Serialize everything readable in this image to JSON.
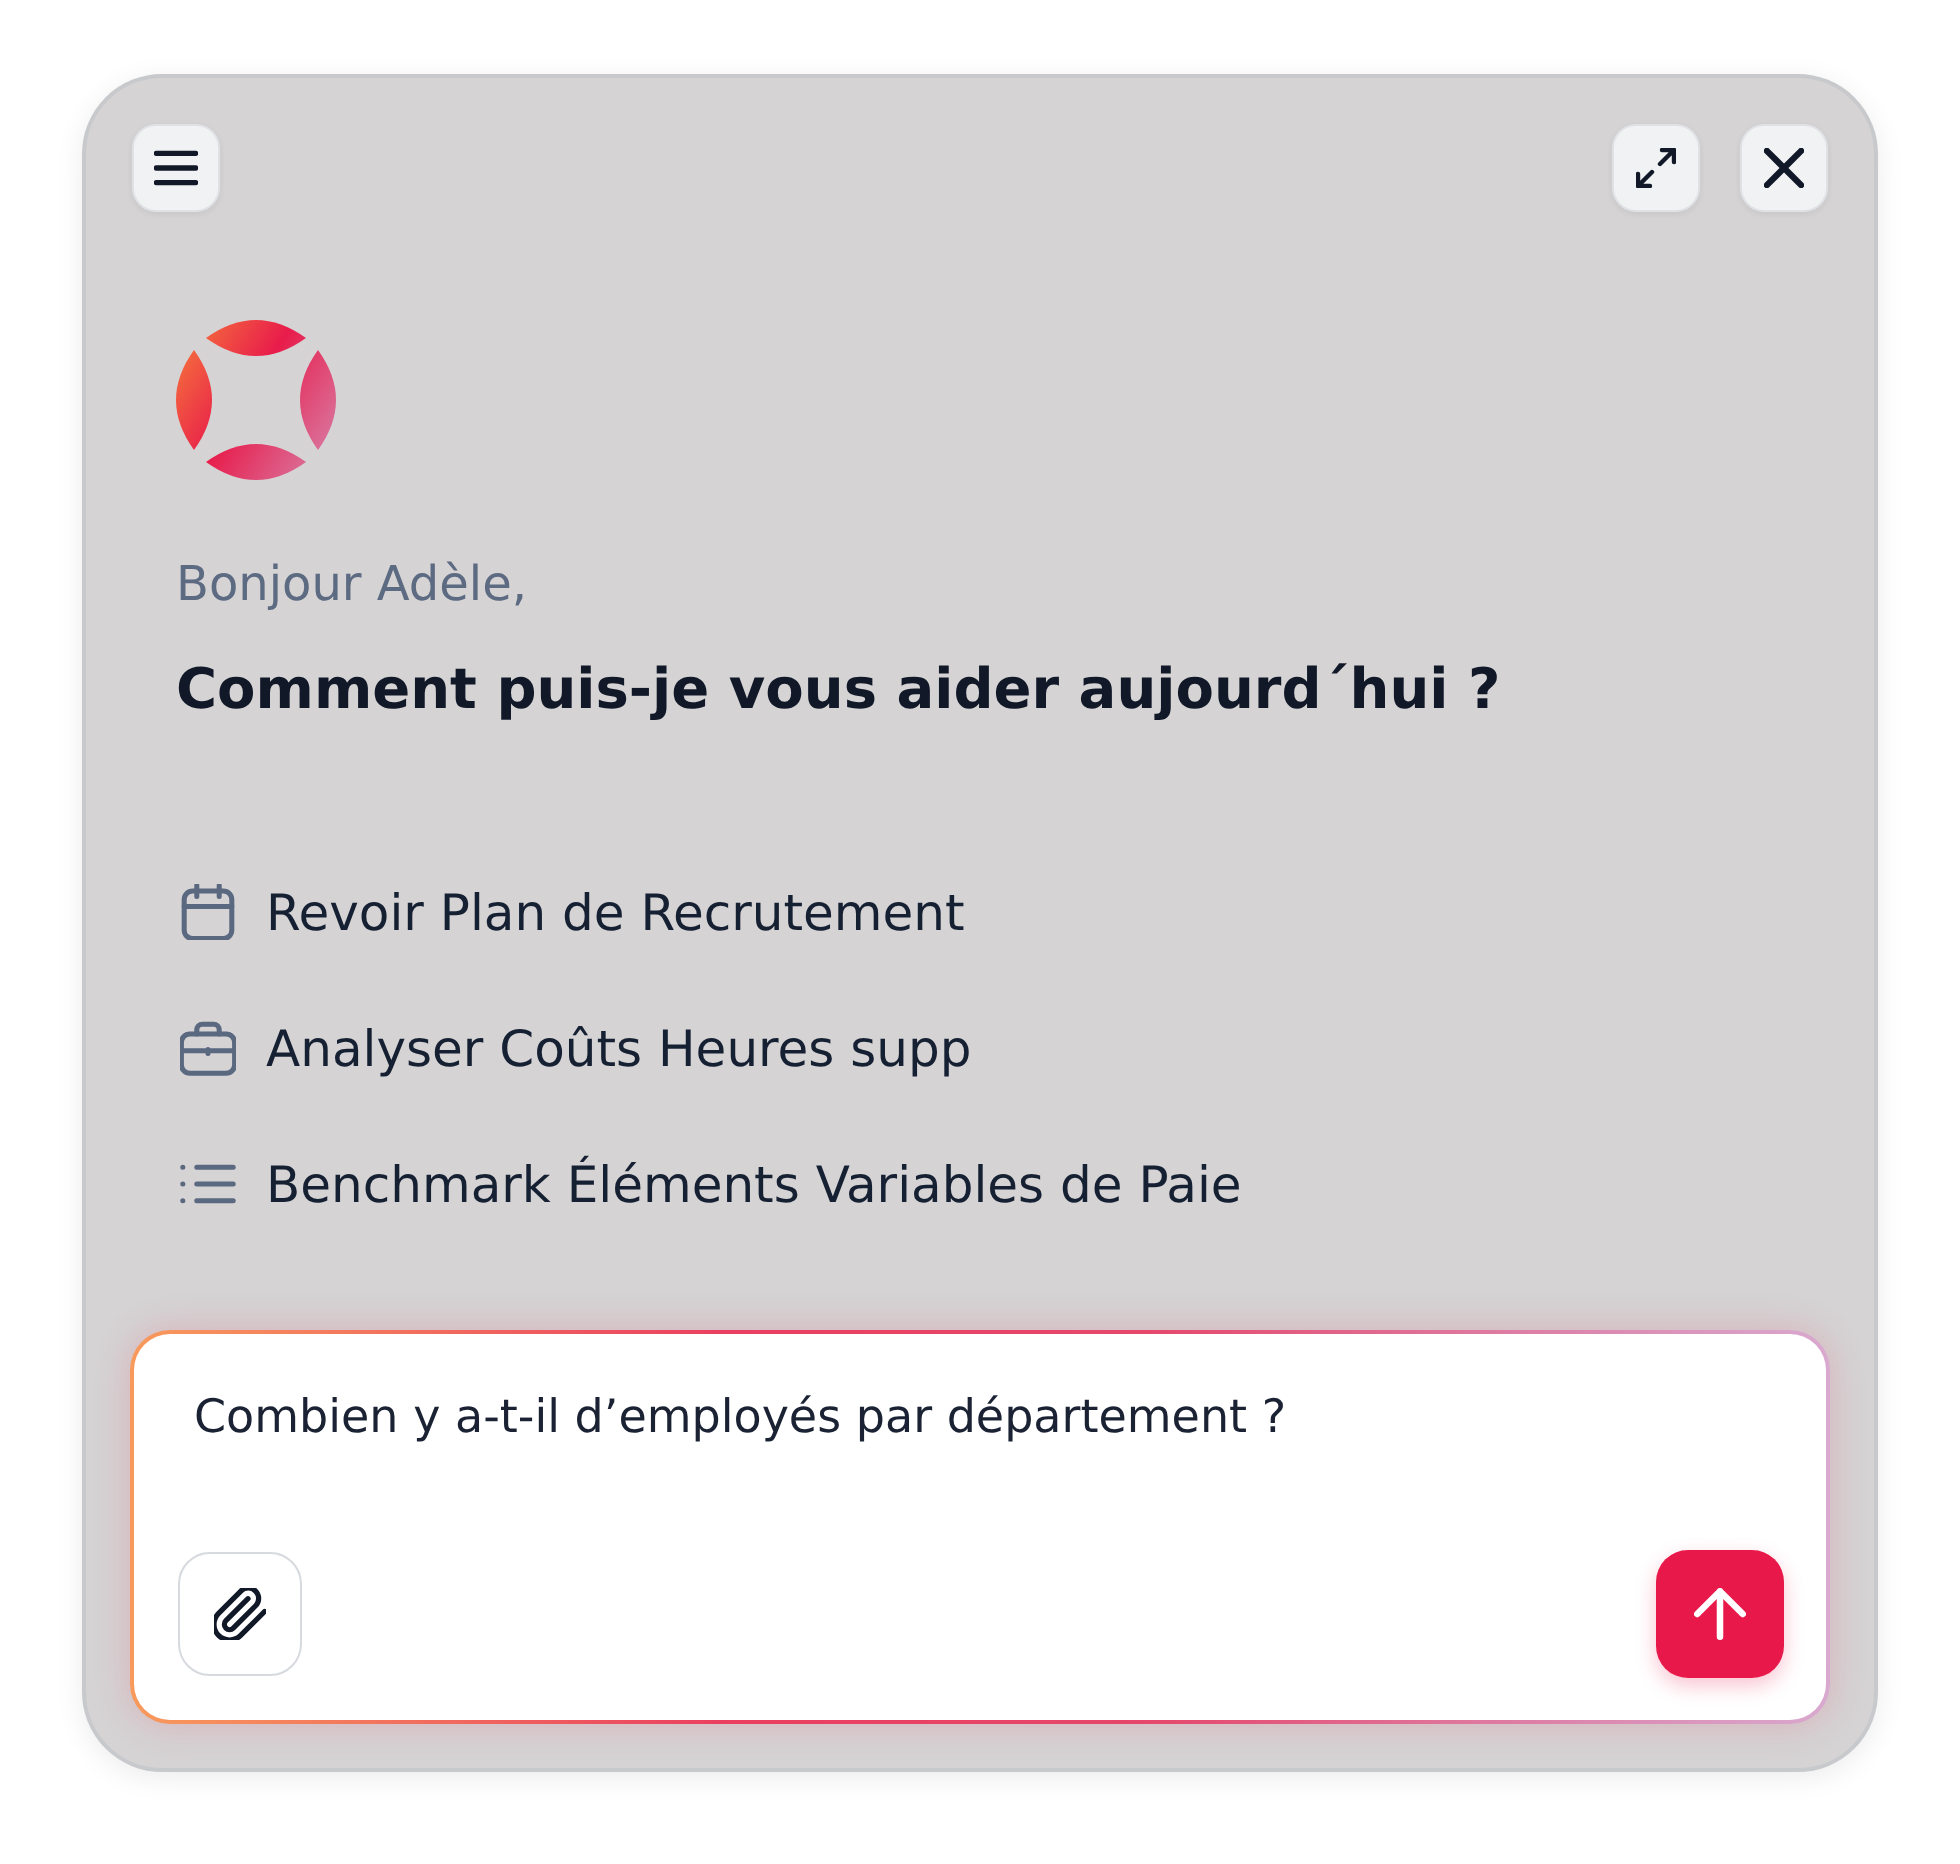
{
  "greeting": "Bonjour Adèle,",
  "heading": "Comment puis-je vous aider aujourd´hui ?",
  "suggestions": [
    {
      "kind": "calendar",
      "label": "Revoir Plan de Recrutement"
    },
    {
      "kind": "briefcase",
      "label": "Analyser Coûts Heures supp"
    },
    {
      "kind": "list",
      "label": "Benchmark Éléments Variables de Paie"
    }
  ],
  "composer": {
    "value": "Combien y a-t-il d’employés par département ?"
  }
}
